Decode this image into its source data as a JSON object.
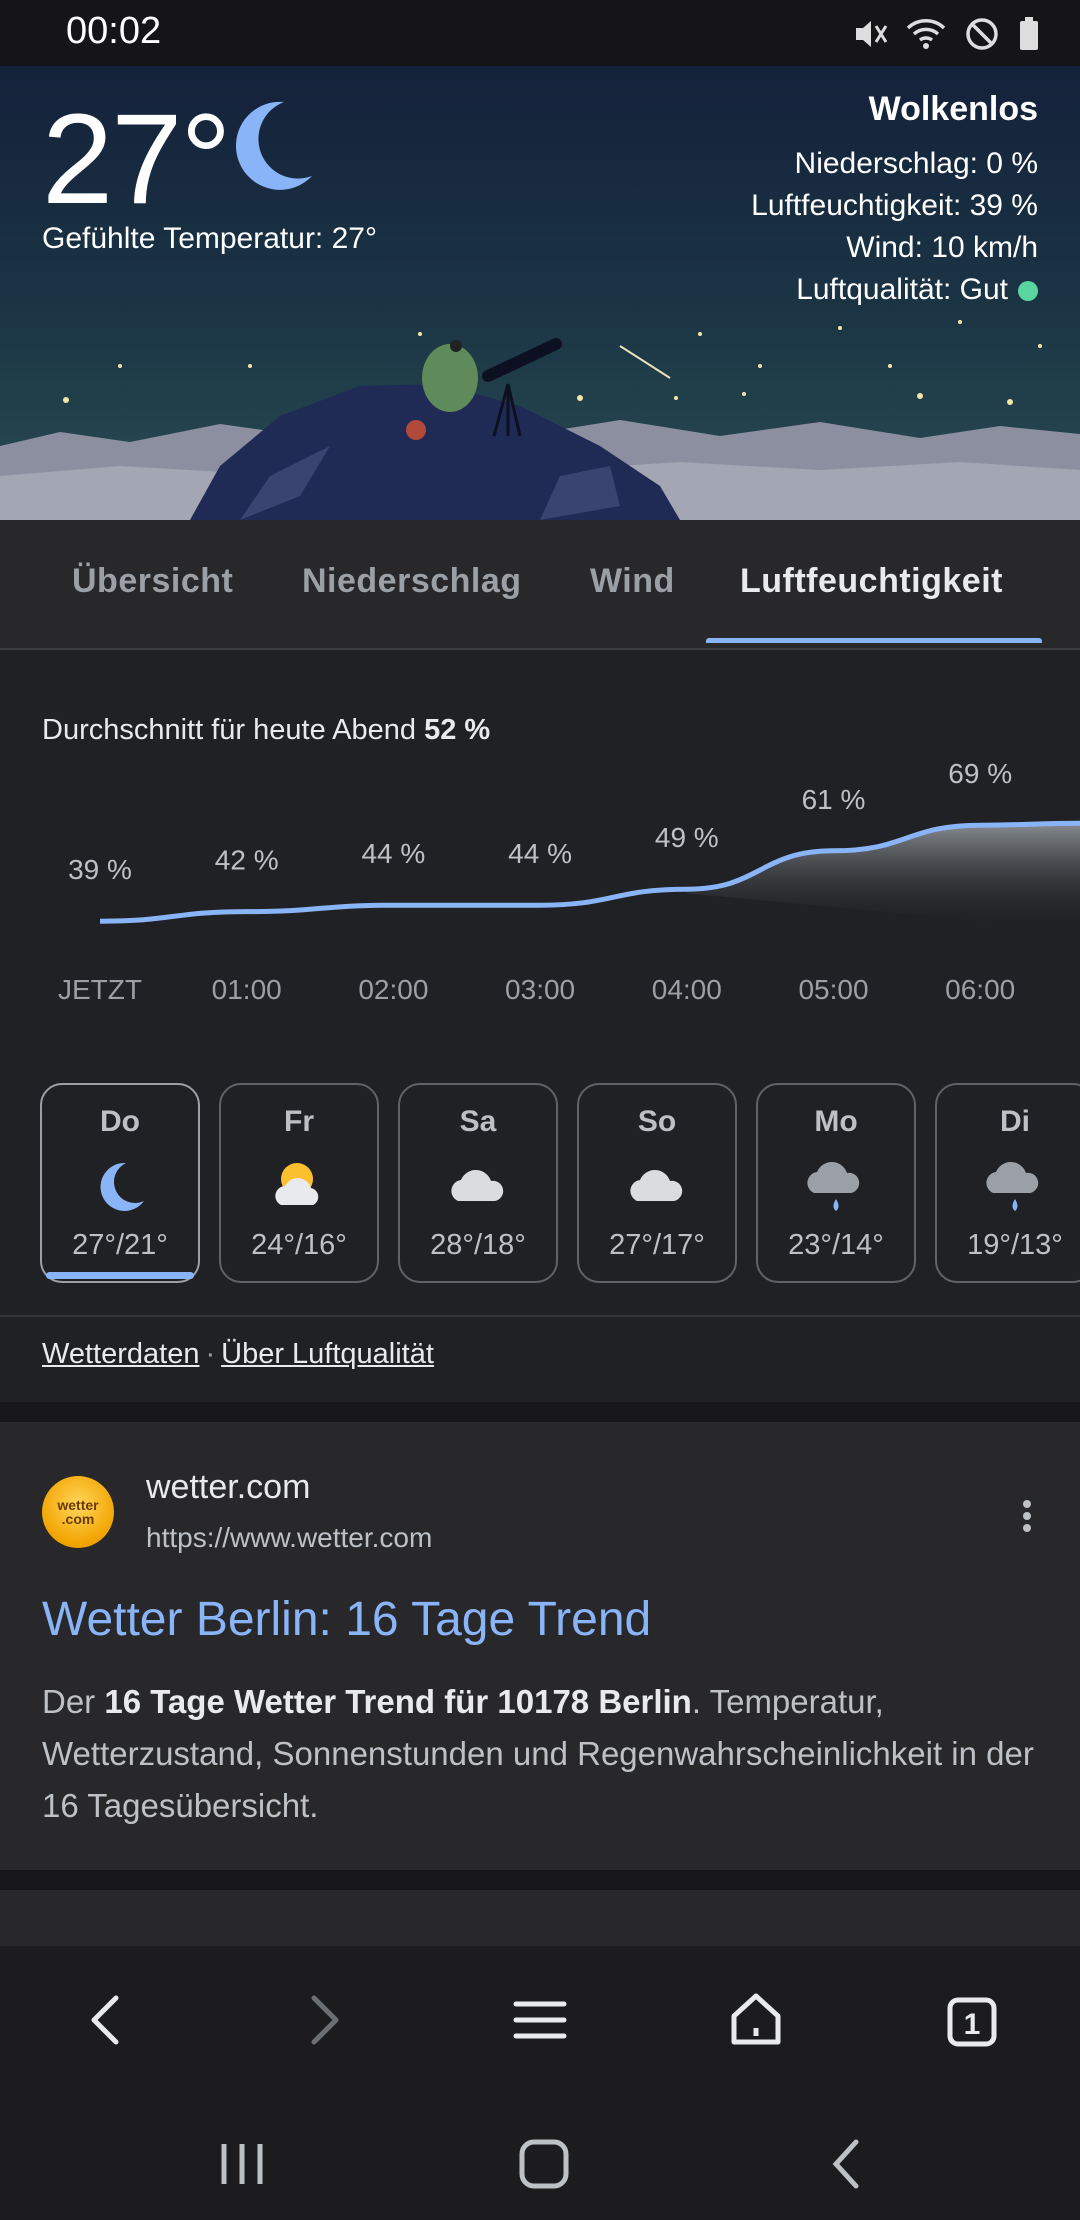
{
  "status": {
    "time": "00:02"
  },
  "weather": {
    "temperature": "27°",
    "feels_like": "Gefühlte Temperatur: 27°",
    "condition": "Wolkenlos",
    "precipitation": "Niederschlag: 0 %",
    "humidity": "Luftfeuchtigkeit: 39 %",
    "wind": "Wind: 10 km/h",
    "air_quality": "Luftqualität: Gut",
    "air_quality_color": "#5bd5a0"
  },
  "tabs": [
    {
      "label": "Übersicht"
    },
    {
      "label": "Niederschlag"
    },
    {
      "label": "Wind"
    },
    {
      "label": "Luftfeuchtigkeit",
      "active": true
    }
  ],
  "humidity_chart": {
    "average_label": "Durchschnitt für heute Abend",
    "average_value": "52 %"
  },
  "chart_data": {
    "type": "area",
    "x": [
      "JETZT",
      "01:00",
      "02:00",
      "03:00",
      "04:00",
      "05:00",
      "06:00"
    ],
    "values": [
      39,
      42,
      44,
      44,
      49,
      61,
      69
    ],
    "labels": [
      "39 %",
      "42 %",
      "44 %",
      "44 %",
      "49 %",
      "61 %",
      "69 %"
    ],
    "color": "#8ab4f8"
  },
  "days": [
    {
      "name": "Do",
      "icon": "moon-icon",
      "temps": "27°/21°",
      "active": true
    },
    {
      "name": "Fr",
      "icon": "sun-cloud-icon",
      "temps": "24°/16°"
    },
    {
      "name": "Sa",
      "icon": "cloud-icon",
      "temps": "28°/18°"
    },
    {
      "name": "So",
      "icon": "cloud-icon",
      "temps": "27°/17°"
    },
    {
      "name": "Mo",
      "icon": "rain-cloud-icon",
      "temps": "23°/14°"
    },
    {
      "name": "Di",
      "icon": "rain-cloud-icon",
      "temps": "19°/13°"
    }
  ],
  "links": {
    "data": "Wetterdaten",
    "sep": "·",
    "aq": "Über Luftqualität"
  },
  "result": {
    "favicon_text": "wetter .com",
    "site_name": "wetter.com",
    "url": "https://www.wetter.com",
    "title": "Wetter Berlin: 16 Tage Trend",
    "snippet_pre": "Der ",
    "snippet_bold": "16 Tage Wetter Trend für 10178 Berlin",
    "snippet_post": ". Temperatur, Wetterzustand, Sonnenstunden und Regenwahrscheinlichkeit in der 16 Tagesübersicht."
  },
  "browser_nav": {
    "tab_count": "1"
  }
}
